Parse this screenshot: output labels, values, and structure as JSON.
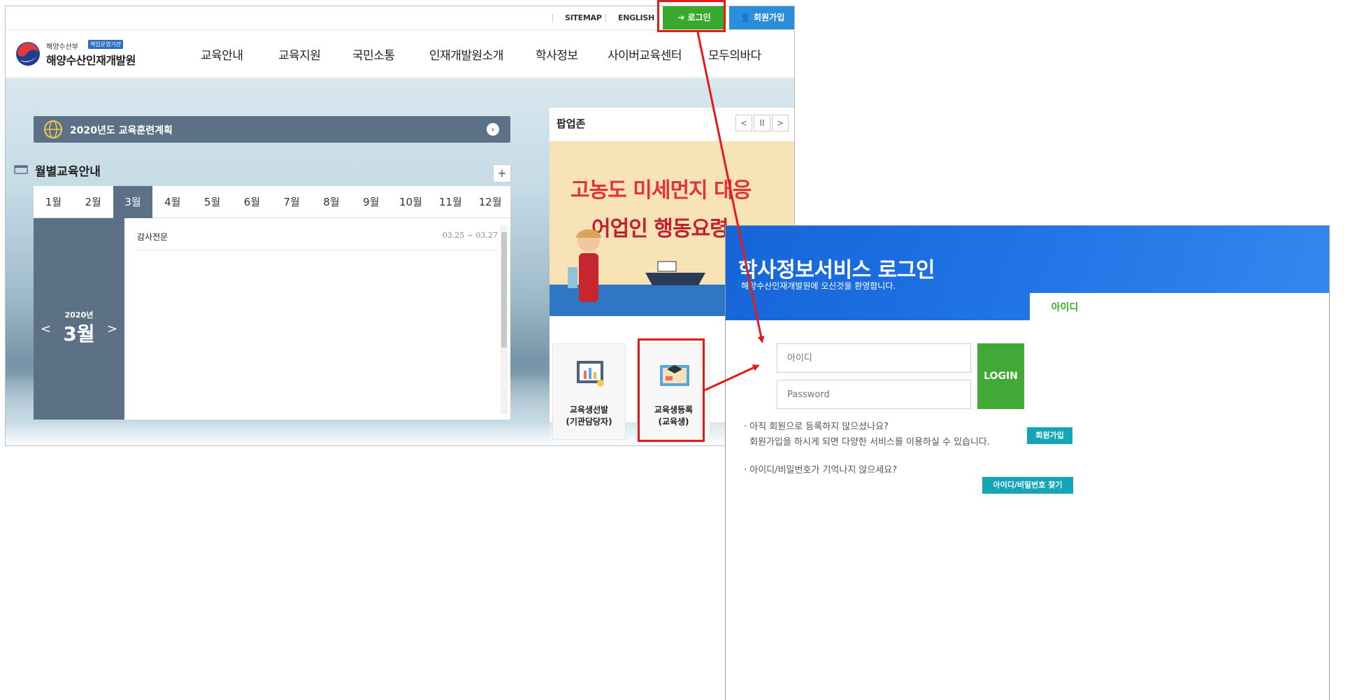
{
  "topbar": {
    "sitemap": "SITEMAP",
    "english": "ENGLISH",
    "login": "로그인",
    "join": "회원가입"
  },
  "header": {
    "logo_sub": "해양수산부",
    "logo_badge": "책임운영기관",
    "logo_main": "해양수산인재개발원",
    "nav": [
      "교육안내",
      "교육지원",
      "국민소통",
      "인재개발원소개",
      "학사정보",
      "사이버교육센터",
      "모두의바다"
    ]
  },
  "plan": {
    "title": "2020년도 교육훈련계획"
  },
  "monthly": {
    "title": "월별교육안내",
    "plus": "+",
    "months": [
      "1월",
      "2월",
      "3월",
      "4월",
      "5월",
      "6월",
      "7월",
      "8월",
      "9월",
      "10월",
      "11월",
      "12월"
    ],
    "active_month": "3월",
    "year": "2020년",
    "month": "3월",
    "prev": "<",
    "next": ">",
    "course": {
      "name": "감사전문",
      "date": "03.25 ~ 03.27"
    }
  },
  "popupzone": {
    "title": "팝업존",
    "controls": [
      "<",
      "II",
      ">"
    ],
    "banner_line1": "고농도 미세먼지 대응",
    "banner_line2": "어업인 행동요령"
  },
  "quick": [
    {
      "label1": "교육생선발",
      "label2": "(기관담당자)"
    },
    {
      "label1": "교육생등록",
      "label2": "(교육생)"
    }
  ],
  "login_popup": {
    "title": "학사정보서비스 로그인",
    "subtitle": "해양수산인재개발원에 오신것을 환영합니다.",
    "tab": "아이디",
    "id_placeholder": "아이디",
    "pw_placeholder": "Password",
    "login_button": "LOGIN",
    "join_q1": "· 아직 회원으로 등록하지 않으셨나요?",
    "join_q2": "회원가입을 하시게 되면 다양한 서비스를 이용하실 수 있습니다.",
    "join_button": "회원가입",
    "find_q": "· 아이디/비밀번호가 기억나지 않으세요?",
    "find_button": "아이디/비밀번호 찾기"
  },
  "colors": {
    "login_green": "#3aa82c",
    "join_blue": "#2a8fd8",
    "slate": "#5c7186",
    "popup_blue": "#1e6fe0",
    "teal_button": "#14a6b7",
    "annotation_red": "#e41b17"
  }
}
